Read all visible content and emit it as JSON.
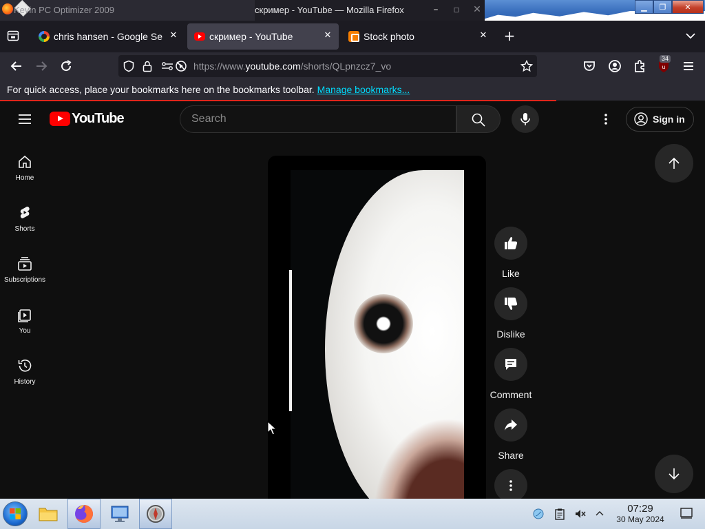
{
  "window": {
    "background_title": "Kevin PC Optimizer 2009",
    "title": "скример - YouTube — Mozilla Firefox",
    "controls": [
      "_",
      "□",
      "✕"
    ]
  },
  "tabs": [
    {
      "label": "chris hansen - Google Se",
      "favicon": "google-icon",
      "active": false
    },
    {
      "label": "скример - YouTube",
      "favicon": "youtube-icon",
      "active": true
    },
    {
      "label": "Stock photo",
      "favicon": "blogger-icon",
      "active": false
    }
  ],
  "new_tab": "+",
  "url": {
    "prefix": "https://www.",
    "host": "youtube.com",
    "path": "/shorts/QLpnzcz7_vo"
  },
  "extension_badge": "34",
  "bookmarks": {
    "message": "For quick access, place your bookmarks here on the bookmarks toolbar.",
    "link": "Manage bookmarks..."
  },
  "youtube": {
    "logo_text": "YouTube",
    "search_placeholder": "Search",
    "signin_label": "Sign in",
    "sidebar": [
      {
        "label": "Home",
        "icon": "home-icon"
      },
      {
        "label": "Shorts",
        "icon": "shorts-icon"
      },
      {
        "label": "Subscriptions",
        "icon": "subscriptions-icon"
      },
      {
        "label": "You",
        "icon": "you-icon"
      },
      {
        "label": "History",
        "icon": "history-icon"
      }
    ],
    "actions": [
      {
        "label": "Like",
        "icon": "thumbs-up-icon"
      },
      {
        "label": "Dislike",
        "icon": "thumbs-down-icon"
      },
      {
        "label": "Comment",
        "icon": "comment-icon"
      },
      {
        "label": "Share",
        "icon": "share-icon"
      }
    ]
  },
  "taskbar": {
    "time": "07:29",
    "date": "30 May 2024"
  },
  "colors": {
    "yt_bg": "#0f0f0f",
    "yt_red": "#ff0000",
    "firefox_tab_active": "#42414d",
    "link": "#00ddff"
  }
}
